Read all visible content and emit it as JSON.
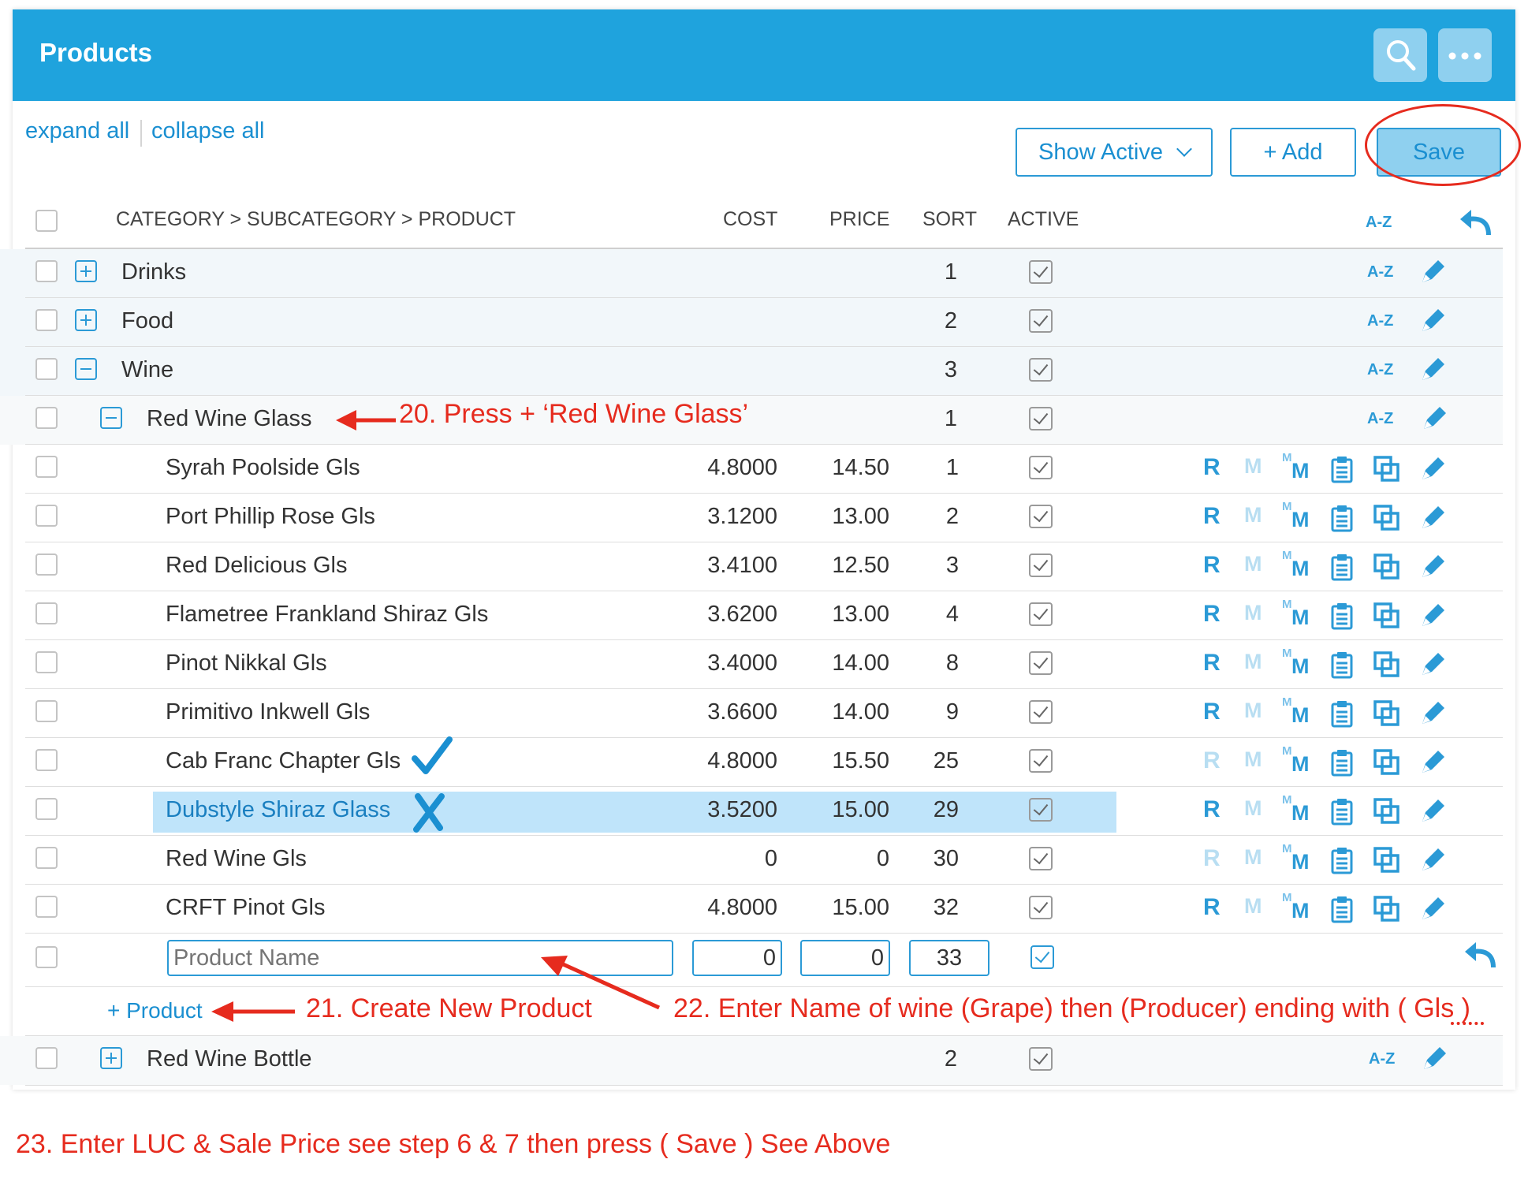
{
  "header": {
    "title": "Products"
  },
  "toolbar": {
    "expand_all": "expand all",
    "collapse_all": "collapse all",
    "filter_label": "Show Active",
    "add_label": "+ Add",
    "save_label": "Save"
  },
  "columns": {
    "path": "CATEGORY > SUBCATEGORY > PRODUCT",
    "cost": "COST",
    "price": "PRICE",
    "sort": "SORT",
    "active": "ACTIVE",
    "az": "A-Z"
  },
  "categories": [
    {
      "name": "Drinks",
      "sort": "1"
    },
    {
      "name": "Food",
      "sort": "2"
    },
    {
      "name": "Wine",
      "sort": "3"
    }
  ],
  "subcategory": {
    "name": "Red Wine Glass",
    "sort": "1"
  },
  "products": [
    {
      "name": "Syrah Poolside Gls",
      "cost": "4.8000",
      "price": "14.50",
      "sort": "1",
      "r_active": true
    },
    {
      "name": "Port Phillip Rose Gls",
      "cost": "3.1200",
      "price": "13.00",
      "sort": "2",
      "r_active": true
    },
    {
      "name": "Red Delicious Gls",
      "cost": "3.4100",
      "price": "12.50",
      "sort": "3",
      "r_active": true
    },
    {
      "name": "Flametree Frankland Shiraz Gls",
      "cost": "3.6200",
      "price": "13.00",
      "sort": "4",
      "r_active": true
    },
    {
      "name": "Pinot Nikkal Gls",
      "cost": "3.4000",
      "price": "14.00",
      "sort": "8",
      "r_active": true
    },
    {
      "name": "Primitivo Inkwell Gls",
      "cost": "3.6600",
      "price": "14.00",
      "sort": "9",
      "r_active": true
    },
    {
      "name": "Cab Franc Chapter Gls",
      "cost": "4.8000",
      "price": "15.50",
      "sort": "25",
      "r_active": false
    },
    {
      "name": "Dubstyle Shiraz Glass",
      "cost": "3.5200",
      "price": "15.00",
      "sort": "29",
      "r_active": true,
      "selected": true
    },
    {
      "name": "Red Wine Gls",
      "cost": "0",
      "price": "0",
      "sort": "30",
      "r_active": false
    },
    {
      "name": "CRFT Pinot Gls",
      "cost": "4.8000",
      "price": "15.00",
      "sort": "32",
      "r_active": true
    }
  ],
  "new_row": {
    "placeholder": "Product Name",
    "cost": "0",
    "price": "0",
    "sort": "33"
  },
  "add_product": "+ Product",
  "next_subcategory": {
    "name": "Red Wine Bottle",
    "sort": "2"
  },
  "row_icons": {
    "r": "R",
    "m": "M",
    "mm": "M",
    "mm_small": "M"
  },
  "annotations": {
    "step20": "20. Press + ‘Red Wine Glass’",
    "step21": "21. Create New Product",
    "step22": "22. Enter Name of wine (Grape) then (Producer) ending with ( Gls )",
    "step23": "23. Enter LUC & Sale Price see step 6 & 7 then press ( Save ) See Above"
  },
  "colors": {
    "header": "#1fa3dd",
    "accent": "#2b9ad6",
    "annotation": "#e62b1e",
    "selected": "#bfe4fa"
  }
}
